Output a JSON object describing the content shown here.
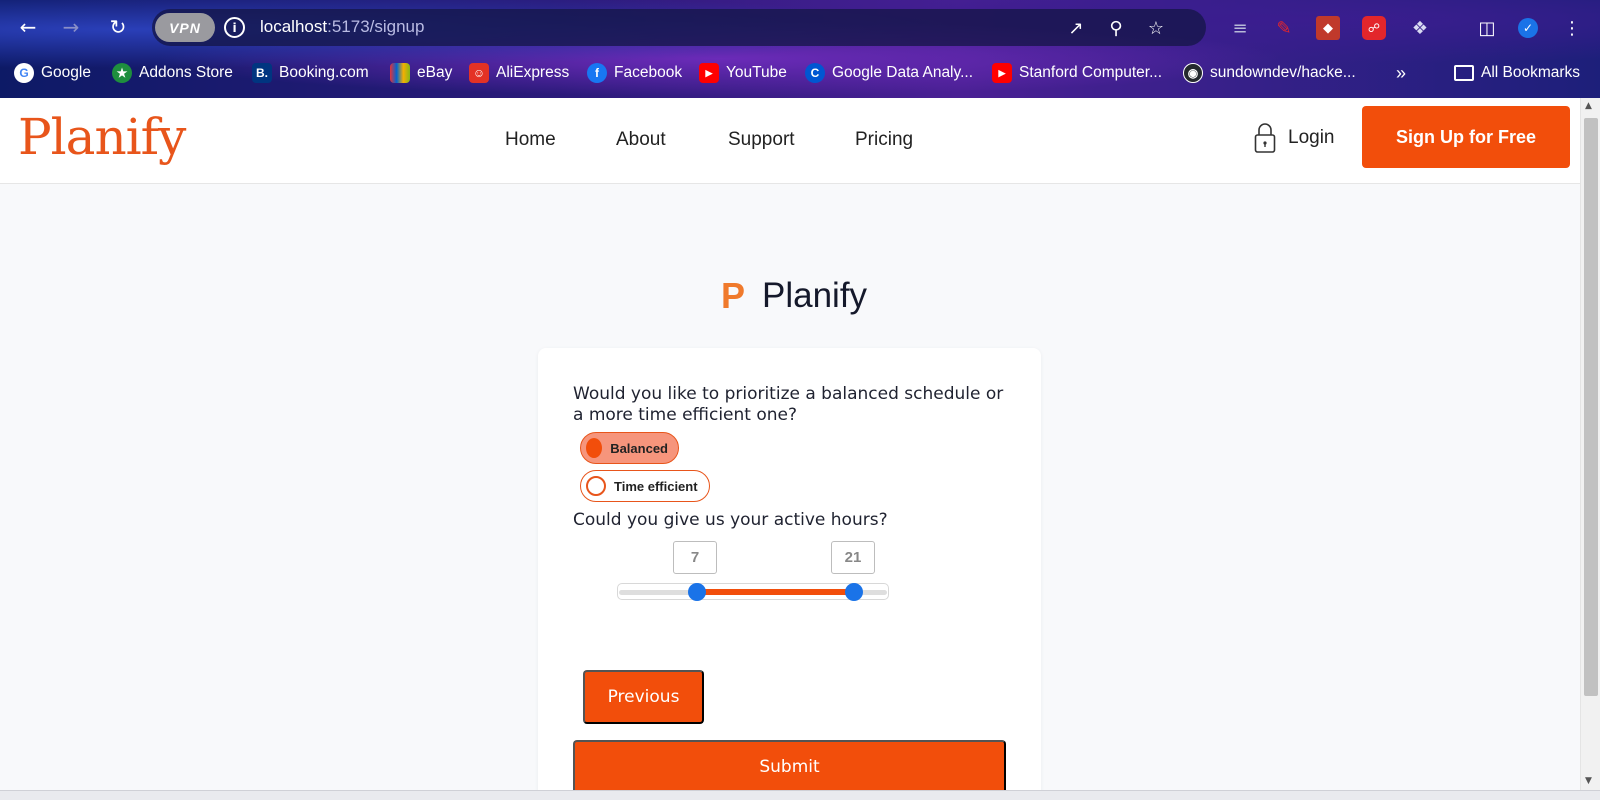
{
  "browser": {
    "vpn_label": "VPN",
    "url_host": "localhost",
    "url_path": ":5173/signup",
    "bookmarks": [
      {
        "label": "Google",
        "icon": "google-icon",
        "color": "#ffffff"
      },
      {
        "label": "Addons Store",
        "icon": "addons-store-icon",
        "color": "#1e8e3e"
      },
      {
        "label": "Booking.com",
        "icon": "booking-icon",
        "color": "#003580"
      },
      {
        "label": "eBay",
        "icon": "ebay-icon",
        "color": "#e53238"
      },
      {
        "label": "AliExpress",
        "icon": "aliexpress-icon",
        "color": "#e43225"
      },
      {
        "label": "Facebook",
        "icon": "facebook-icon",
        "color": "#1877f2"
      },
      {
        "label": "YouTube",
        "icon": "youtube-icon",
        "color": "#ff0000"
      },
      {
        "label": "Google Data Analy...",
        "icon": "coursera-icon",
        "color": "#0056d2"
      },
      {
        "label": "Stanford Computer...",
        "icon": "youtube-icon",
        "color": "#ff0000"
      },
      {
        "label": "sundowndev/hacke...",
        "icon": "github-icon",
        "color": "#24292e"
      }
    ],
    "overflow_label": "»",
    "all_bookmarks_label": "All Bookmarks"
  },
  "site": {
    "logo": "Planify",
    "nav": [
      "Home",
      "About",
      "Support",
      "Pricing"
    ],
    "login_label": "Login",
    "signup_label": "Sign Up for Free",
    "accent": "#f24e0b"
  },
  "brand": {
    "mark": "P",
    "name": "Planify"
  },
  "form": {
    "question_schedule": "Would you like to prioritize a balanced schedule or a more time efficient one?",
    "options": [
      {
        "label": "Balanced",
        "selected": true
      },
      {
        "label": "Time efficient",
        "selected": false
      }
    ],
    "question_hours": "Could you give us your active hours?",
    "hours_start": "7",
    "hours_end": "21",
    "slider_min": 0,
    "slider_max": 24,
    "previous_label": "Previous",
    "submit_label": "Submit"
  }
}
